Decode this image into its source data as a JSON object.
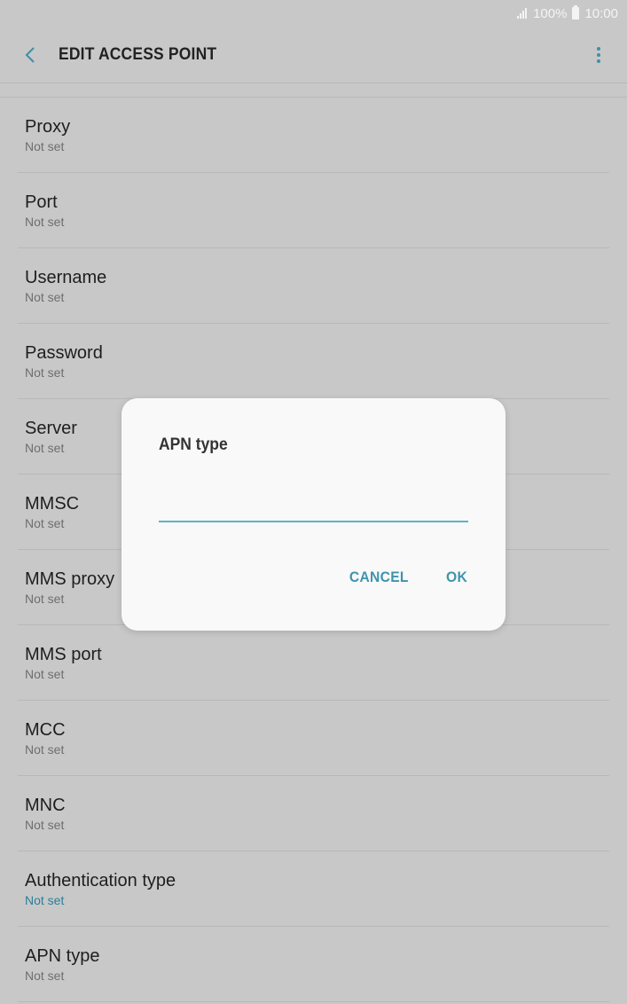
{
  "status": {
    "battery_text": "100%",
    "time": "10:00"
  },
  "header": {
    "title": "EDIT ACCESS POINT",
    "back_icon": "chevron-left-icon",
    "more_icon": "more-vertical-icon"
  },
  "items": [
    {
      "title": "Proxy",
      "value": "Not set"
    },
    {
      "title": "Port",
      "value": "Not set"
    },
    {
      "title": "Username",
      "value": "Not set"
    },
    {
      "title": "Password",
      "value": "Not set"
    },
    {
      "title": "Server",
      "value": "Not set"
    },
    {
      "title": "MMSC",
      "value": "Not set"
    },
    {
      "title": "MMS proxy",
      "value": "Not set"
    },
    {
      "title": "MMS port",
      "value": "Not set"
    },
    {
      "title": "MCC",
      "value": "Not set"
    },
    {
      "title": "MNC",
      "value": "Not set"
    },
    {
      "title": "Authentication type",
      "value": "Not set"
    },
    {
      "title": "APN type",
      "value": "Not set"
    }
  ],
  "dialog": {
    "title": "APN type",
    "input_value": "",
    "cancel_label": "CANCEL",
    "ok_label": "OK"
  },
  "colors": {
    "accent": "#3d95ad",
    "background": "#c8c8c8",
    "dialog_bg": "#f9f9f9"
  }
}
